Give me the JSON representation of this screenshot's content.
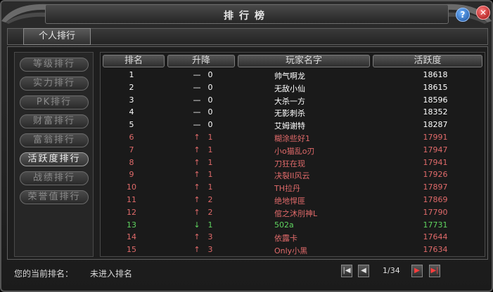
{
  "window": {
    "title": "排行榜",
    "help_label": "?",
    "close_label": "✕"
  },
  "tabs": [
    {
      "label": "个人排行",
      "active": true
    }
  ],
  "categories": [
    {
      "label": "等级排行",
      "active": false
    },
    {
      "label": "实力排行",
      "active": false
    },
    {
      "label": "PK排行",
      "active": false
    },
    {
      "label": "财富排行",
      "active": false
    },
    {
      "label": "富翁排行",
      "active": false
    },
    {
      "label": "活跃度排行",
      "active": true
    },
    {
      "label": "战绩排行",
      "active": false
    },
    {
      "label": "荣誉值排行",
      "active": false
    }
  ],
  "table": {
    "headers": {
      "rank": "排名",
      "change": "升降",
      "name": "玩家名字",
      "value": "活跃度"
    },
    "rows": [
      {
        "rank": "1",
        "dir": "—",
        "change": "0",
        "name": "帅气啊龙",
        "value": "18618",
        "color": "#ffffff"
      },
      {
        "rank": "2",
        "dir": "—",
        "change": "0",
        "name": "无敌小仙",
        "value": "18615",
        "color": "#ffffff"
      },
      {
        "rank": "3",
        "dir": "—",
        "change": "0",
        "name": "大杀一方",
        "value": "18596",
        "color": "#ffffff"
      },
      {
        "rank": "4",
        "dir": "—",
        "change": "0",
        "name": "无影刺杀",
        "value": "18352",
        "color": "#ffffff"
      },
      {
        "rank": "5",
        "dir": "—",
        "change": "0",
        "name": "艾姆谢特",
        "value": "18287",
        "color": "#ffffff"
      },
      {
        "rank": "6",
        "dir": "↑",
        "change": "1",
        "name": "糊涂些好1",
        "value": "17991",
        "color": "#e06a6a"
      },
      {
        "rank": "7",
        "dir": "↑",
        "change": "1",
        "name": "小ο猫乱ο刃",
        "value": "17947",
        "color": "#e06a6a"
      },
      {
        "rank": "8",
        "dir": "↑",
        "change": "1",
        "name": "刀狂在现",
        "value": "17941",
        "color": "#e06a6a"
      },
      {
        "rank": "9",
        "dir": "↑",
        "change": "1",
        "name": "决裂II风云",
        "value": "17926",
        "color": "#e06a6a"
      },
      {
        "rank": "10",
        "dir": "↑",
        "change": "1",
        "name": "TH拉丹",
        "value": "17897",
        "color": "#e06a6a"
      },
      {
        "rank": "11",
        "dir": "↑",
        "change": "2",
        "name": "绝地悍匪",
        "value": "17869",
        "color": "#e06a6a"
      },
      {
        "rank": "12",
        "dir": "↑",
        "change": "2",
        "name": "倌之沐刖神L",
        "value": "17790",
        "color": "#e06a6a"
      },
      {
        "rank": "13",
        "dir": "↓",
        "change": "1",
        "name": "502a",
        "value": "17731",
        "color": "#5fd35f"
      },
      {
        "rank": "14",
        "dir": "↑",
        "change": "3",
        "name": "依露卡",
        "value": "17644",
        "color": "#e06a6a"
      },
      {
        "rank": "15",
        "dir": "↑",
        "change": "3",
        "name": "Only小黑",
        "value": "17634",
        "color": "#e06a6a"
      }
    ]
  },
  "status": {
    "label": "您的当前排名：",
    "value": "未进入排名"
  },
  "pagination": {
    "first": "|◀",
    "prev": "◀",
    "info": "1/34",
    "next": "▶",
    "last": "▶|"
  }
}
